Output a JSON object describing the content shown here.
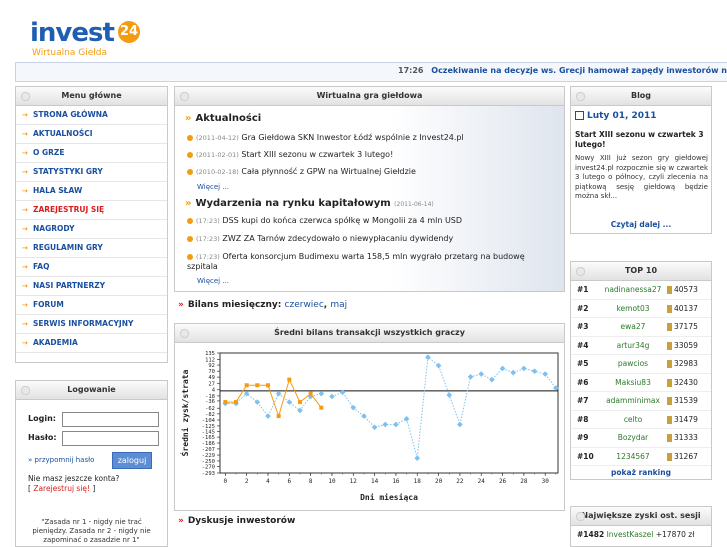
{
  "logo": {
    "word": "invest",
    "num": "24",
    "subtitle": "Wirtualna Giełda"
  },
  "ticker": {
    "time": "17:26",
    "text": "Oczekiwanie na decyzje ws. Grecji hamował zapędy inwestorów na rynku"
  },
  "menu": {
    "title": "Menu główne",
    "items": [
      "STRONA GŁÓWNA",
      "AKTUALNOŚCI",
      "O GRZE",
      "STATYSTYKI GRY",
      "HALA SŁAW",
      "ZAREJESTRUJ SIĘ",
      "NAGRODY",
      "REGULAMIN GRY",
      "FAQ",
      "NASI PARTNERZY",
      "FORUM",
      "SERWIS INFORMACYJNY",
      "AKADEMIA"
    ]
  },
  "login": {
    "title": "Logowanie",
    "login_label": "Login:",
    "password_label": "Hasło:",
    "button": "zaloguj",
    "forgot": "przypomnij hasło",
    "no_account": "Nie masz jeszcze konta?",
    "register_open": "[ ",
    "register_link": "Zarejestruj się!",
    "register_close": " ]",
    "quote": "\"Zasada nr 1 - nigdy nie trać pieniędzy. Zasada nr 2 - nigdy nie zapominać o zasadzie nr 1\""
  },
  "game": {
    "title": "Wirtualna gra giełdowa",
    "news_title": "Aktualności",
    "news": [
      {
        "date": "(2011-04-12)",
        "text": "Gra Giełdowa SKN Inwestor Łódź wspólnie z Invest24.pl"
      },
      {
        "date": "(2011-02-01)",
        "text": "Start XIII sezonu w czwartek 3 lutego!"
      },
      {
        "date": "(2010-02-18)",
        "text": "Cała płynność z GPW na Wirtualnej Giełdzie"
      }
    ],
    "more1": "Więcej ...",
    "events_title": "Wydarzenia na rynku kapitałowym",
    "events_date": "(2011-06-14)",
    "events": [
      {
        "date": "(17:23)",
        "text": "DSS kupi do końca czerwca spółkę w Mongolii za 4 mln USD"
      },
      {
        "date": "(17:23)",
        "text": "ZWZ ZA Tarnów zdecydowało o niewypłacaniu dywidendy"
      },
      {
        "date": "(17:23)",
        "text": "Oferta konsorcjum Budimexu warta 158,5 mln wygrało przetarg na budowę szpitala"
      }
    ],
    "more2": "Więcej ..."
  },
  "bilans": {
    "label": "Bilans miesięczny:",
    "link1": "czerwiec",
    "sep": ",",
    "link2": "maj"
  },
  "chart_box_title": "Średni bilans transakcji wszystkich graczy",
  "chart_data": {
    "type": "line",
    "xlabel": "Dni miesiąca",
    "ylabel": "Średni zysk/strata",
    "yticks": [
      135,
      112,
      92,
      70,
      49,
      27,
      4,
      -18,
      -36,
      -62,
      -82,
      -104,
      -125,
      -145,
      -165,
      -186,
      -207,
      -229,
      -250,
      -270,
      -293
    ],
    "xticks": [
      0,
      2,
      4,
      6,
      8,
      10,
      12,
      14,
      16,
      18,
      20,
      22,
      24,
      26,
      28,
      30
    ],
    "xlim": [
      -0.5,
      31.2
    ],
    "ylim": [
      -293,
      135
    ],
    "series": [
      {
        "color": "#f39c12",
        "x": [
          0,
          1,
          2,
          3,
          4,
          5,
          6,
          7,
          8,
          9
        ],
        "y": [
          -40,
          -40,
          20,
          20,
          20,
          -90,
          40,
          -40,
          -10,
          -60
        ]
      },
      {
        "color": "#7ec0ee",
        "x": [
          10,
          11,
          12,
          13,
          14,
          15,
          16,
          17,
          18,
          19,
          20,
          21,
          22,
          23,
          24,
          25,
          26,
          27,
          28,
          29,
          30,
          31
        ],
        "y": [
          -20,
          -5,
          -60,
          -90,
          -130,
          -120,
          -120,
          -100,
          -240,
          120,
          90,
          -15,
          -120,
          50,
          60,
          40,
          80,
          65,
          80,
          70,
          60,
          10
        ]
      },
      {
        "color": "#7ec0ee",
        "x": [
          0,
          1,
          2,
          3,
          4,
          5,
          6,
          7,
          8,
          9
        ],
        "y": [
          -45,
          -45,
          -10,
          -40,
          -90,
          -10,
          -40,
          -70,
          -20,
          -10
        ]
      }
    ]
  },
  "discussions": {
    "label": "Dyskusje inwestorów"
  },
  "blog": {
    "title": "Blog",
    "date": "Luty 01, 2011",
    "post_title": "Start XIII sezonu w czwartek 3 lutego!",
    "post_text": "Nowy XIII już sezon gry giełdowej invest24.pl rozpocznie się w czwartek 3 lutego o północy, czyli zlecenia na piątkową sesję giełdową będzie można skł...",
    "more": "Czytaj dalej ..."
  },
  "top10": {
    "title": "TOP 10",
    "rows": [
      {
        "rank": "#1",
        "user": "nadinanessa27",
        "value": "40573"
      },
      {
        "rank": "#2",
        "user": "kemot03",
        "value": "40137"
      },
      {
        "rank": "#3",
        "user": "ewa27",
        "value": "37175"
      },
      {
        "rank": "#4",
        "user": "artur34g",
        "value": "33059"
      },
      {
        "rank": "#5",
        "user": "pawcios",
        "value": "32983"
      },
      {
        "rank": "#6",
        "user": "Maksiu83",
        "value": "32430"
      },
      {
        "rank": "#7",
        "user": "adamminimax",
        "value": "31539"
      },
      {
        "rank": "#8",
        "user": "celto",
        "value": "31479"
      },
      {
        "rank": "#9",
        "user": "Bozydar",
        "value": "31333"
      },
      {
        "rank": "#10",
        "user": "1234567",
        "value": "31267"
      }
    ],
    "more": "pokaż ranking"
  },
  "gains": {
    "title": "Największe zyski ost. sesji",
    "row": {
      "rank": "#1482",
      "user": "InvestKaszel",
      "value": "+17870 zł"
    }
  }
}
